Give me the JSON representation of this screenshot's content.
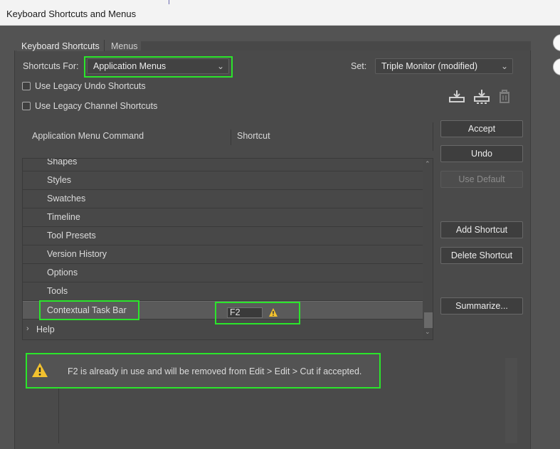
{
  "window": {
    "title": "Keyboard Shortcuts and Menus"
  },
  "tabs": [
    {
      "label": "Keyboard Shortcuts"
    },
    {
      "label": "Menus"
    }
  ],
  "shortcuts_for": {
    "label": "Shortcuts For:",
    "value": "Application Menus"
  },
  "set": {
    "label": "Set:",
    "value": "Triple Monitor (modified)"
  },
  "options": {
    "legacy_undo": {
      "label": "Use Legacy Undo Shortcuts",
      "checked": false
    },
    "legacy_channel": {
      "label": "Use Legacy Channel Shortcuts",
      "checked": false
    }
  },
  "icons": {
    "save_set": "save-set-icon",
    "new_set": "new-set-icon",
    "delete_set": "trash-icon",
    "warning": "warning-icon"
  },
  "table": {
    "headers": {
      "command": "Application Menu Command",
      "shortcut": "Shortcut"
    },
    "rows": [
      {
        "label": "Shapes"
      },
      {
        "label": "Styles"
      },
      {
        "label": "Swatches"
      },
      {
        "label": "Timeline"
      },
      {
        "label": "Tool Presets"
      },
      {
        "label": "Version History"
      },
      {
        "label": "Options"
      },
      {
        "label": "Tools"
      },
      {
        "label": "Contextual Task Bar",
        "shortcut": "F2",
        "selected": true
      },
      {
        "label": "Help",
        "collapsed": true
      }
    ]
  },
  "buttons": {
    "accept": "Accept",
    "undo": "Undo",
    "use_default": "Use Default",
    "add_shortcut": "Add Shortcut",
    "delete_shortcut": "Delete Shortcut",
    "summarize": "Summarize..."
  },
  "message": "F2 is already in use and will be removed from Edit > Edit > Cut if accepted.",
  "colors": {
    "highlight": "#2be52b",
    "warning": "#f2c12e"
  }
}
